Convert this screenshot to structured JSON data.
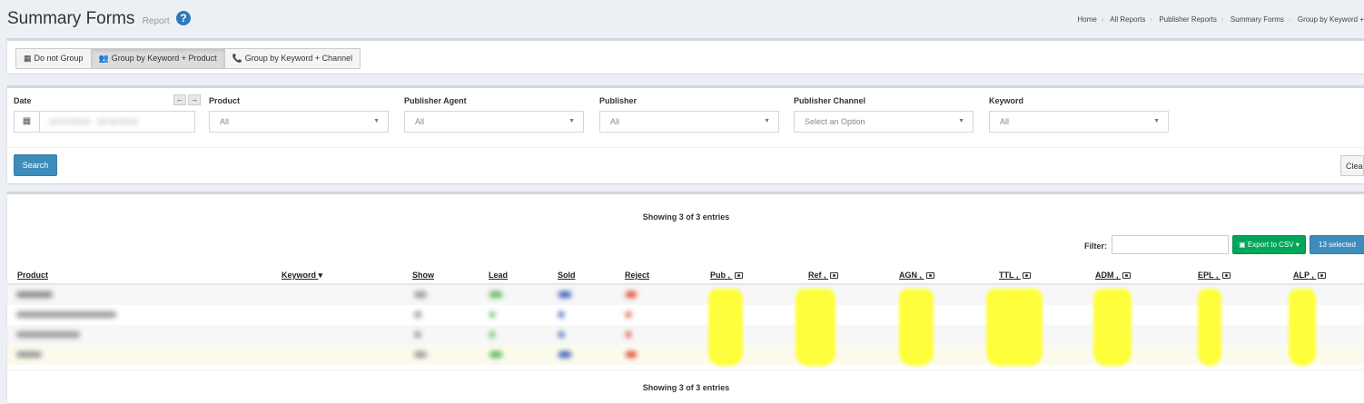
{
  "header": {
    "title": "Summary Forms",
    "subtitle": "Report",
    "help_icon": "question-circle-icon",
    "breadcrumb": [
      "Home",
      "All Reports",
      "Publisher Reports",
      "Summary Forms",
      "Group by Keyword +"
    ]
  },
  "grouping": {
    "buttons": [
      {
        "label": "Do not Group",
        "icon": "calendar-icon",
        "active": false
      },
      {
        "label": "Group by Keyword + Product",
        "icon": "users-icon",
        "active": true
      },
      {
        "label": "Group by Keyword + Channel",
        "icon": "phone-icon",
        "active": false
      }
    ]
  },
  "filters": {
    "date": {
      "label": "Date",
      "value": "01/01/2024 - 01/31/2024",
      "icon": "calendar-icon"
    },
    "product": {
      "label": "Product",
      "value": "All"
    },
    "publisher_agent": {
      "label": "Publisher Agent",
      "value": "All"
    },
    "publisher": {
      "label": "Publisher",
      "value": "All"
    },
    "publisher_channel": {
      "label": "Publisher Channel",
      "placeholder": "Select an Option"
    },
    "keyword": {
      "label": "Keyword",
      "value": "All"
    },
    "search_label": "Search",
    "clear_label": "Clea"
  },
  "table": {
    "showing_text": "Showing 3 of 3 entries",
    "filter_label": "Filter:",
    "filter_value": "",
    "export_label": "Export to CSV",
    "columns_selected_label": "13 selected",
    "columns": [
      {
        "label": "Product",
        "sort": ""
      },
      {
        "label": "Keyword",
        "sort": "desc"
      },
      {
        "label": "Show"
      },
      {
        "label": "Lead"
      },
      {
        "label": "Sold"
      },
      {
        "label": "Reject"
      },
      {
        "label": "Pub",
        "toggle": true
      },
      {
        "label": "Ref",
        "toggle": true
      },
      {
        "label": "AGN",
        "toggle": true
      },
      {
        "label": "TTL",
        "toggle": true
      },
      {
        "label": "ADM",
        "toggle": true
      },
      {
        "label": "EPL",
        "toggle": true
      },
      {
        "label": "ALP",
        "toggle": true
      }
    ],
    "row_count": 3,
    "has_total_row": true,
    "colors": {
      "lead": "#5cb85c",
      "sold": "#3c5dbc",
      "reject": "#dd4b39",
      "highlight": "#ffff33"
    }
  },
  "colors": {
    "primary": "#3c8dbc",
    "success": "#00a65a",
    "background": "#ecf0f5"
  }
}
